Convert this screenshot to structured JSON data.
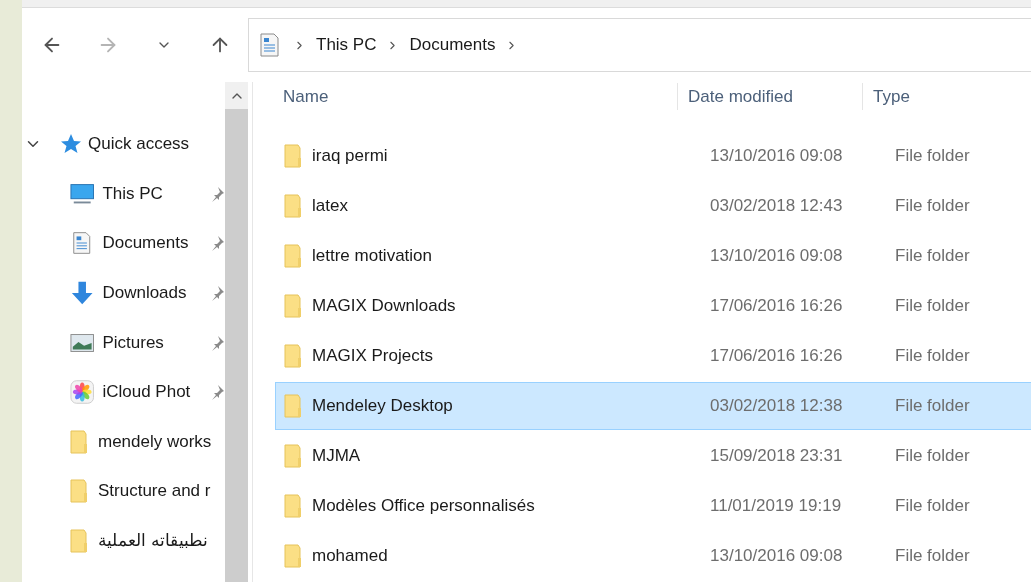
{
  "address_bar": {
    "segments": [
      "This PC",
      "Documents"
    ]
  },
  "navigation_pane": {
    "quick_access": {
      "label": "Quick access",
      "expanded": true
    },
    "items": [
      {
        "label": "This PC",
        "kind": "computer",
        "pinned": true
      },
      {
        "label": "Documents",
        "kind": "document",
        "pinned": true
      },
      {
        "label": "Downloads",
        "kind": "download",
        "pinned": true
      },
      {
        "label": "Pictures",
        "kind": "pictures",
        "pinned": true
      },
      {
        "label": "iCloud Phot",
        "kind": "photos",
        "pinned": true
      },
      {
        "label": "mendely works",
        "kind": "folder",
        "pinned": false
      },
      {
        "label": "Structure and r",
        "kind": "folder",
        "pinned": false
      },
      {
        "label": "نطبيقاته العملية",
        "kind": "folder",
        "pinned": false
      }
    ]
  },
  "file_list": {
    "columns": [
      "Name",
      "Date modified",
      "Type"
    ],
    "rows": [
      {
        "name": "iraq permi",
        "date": "13/10/2016 09:08",
        "type": "File folder",
        "selected": false
      },
      {
        "name": "latex",
        "date": "03/02/2018 12:43",
        "type": "File folder",
        "selected": false
      },
      {
        "name": "lettre motivation",
        "date": "13/10/2016 09:08",
        "type": "File folder",
        "selected": false
      },
      {
        "name": "MAGIX Downloads",
        "date": "17/06/2016 16:26",
        "type": "File folder",
        "selected": false
      },
      {
        "name": "MAGIX Projects",
        "date": "17/06/2016 16:26",
        "type": "File folder",
        "selected": false
      },
      {
        "name": "Mendeley Desktop",
        "date": "03/02/2018 12:38",
        "type": "File folder",
        "selected": true
      },
      {
        "name": "MJMA",
        "date": "15/09/2018 23:31",
        "type": "File folder",
        "selected": false
      },
      {
        "name": "Modèles Office personnalisés",
        "date": "11/01/2019 19:19",
        "type": "File folder",
        "selected": false
      },
      {
        "name": "mohamed",
        "date": "13/10/2016 09:08",
        "type": "File folder",
        "selected": false
      }
    ]
  }
}
